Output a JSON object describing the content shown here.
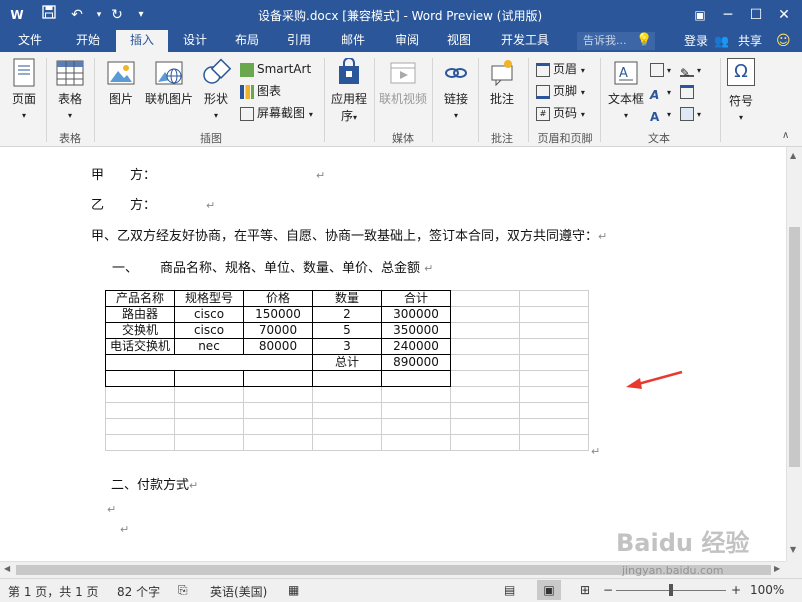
{
  "window": {
    "title": "设备采购.docx [兼容模式] - Word Preview (试用版)",
    "app_icon": "W",
    "qa_icons": [
      "save-icon",
      "undo-icon",
      "redo-icon",
      "customize-icon"
    ]
  },
  "tabs": [
    "文件",
    "开始",
    "插入",
    "设计",
    "布局",
    "引用",
    "邮件",
    "审阅",
    "视图",
    "开发工具"
  ],
  "active_tab": "插入",
  "tell_me": "告诉我...",
  "account": {
    "login": "登录",
    "share": "共享"
  },
  "ribbon": {
    "page": {
      "label": "页面"
    },
    "table": {
      "label": "表格",
      "group": "表格"
    },
    "illustrations": {
      "picture": "图片",
      "online_picture": "联机图片",
      "shapes": "形状",
      "smartart": "SmartArt",
      "chart": "图表",
      "screenshot": "屏幕截图",
      "group": "插图"
    },
    "apps": {
      "label": "应用程",
      "label2": "序"
    },
    "media": {
      "video": "联机视频",
      "group": "媒体"
    },
    "links": {
      "label": "链接"
    },
    "comments": {
      "comment": "批注",
      "group": "批注"
    },
    "header_footer": {
      "header": "页眉",
      "footer": "页脚",
      "page_number": "页码",
      "group": "页眉和页脚"
    },
    "text": {
      "textbox": "文本框",
      "group": "文本"
    },
    "symbols": {
      "symbol": "符号"
    }
  },
  "document": {
    "party_a": "甲　　方：",
    "party_b": "乙　　方：",
    "intro": "甲、乙双方经友好协商，在平等、自愿、协商一致基础上，签订本合同，双方共同遵守：",
    "section1_num": "一、",
    "section1_title": "商品名称、规格、单位、数量、单价、总金额",
    "table": {
      "headers": [
        "产品名称",
        "规格型号",
        "价格",
        "数量",
        "合计"
      ],
      "rows": [
        [
          "路由器",
          "cisco",
          "150000",
          "2",
          "300000"
        ],
        [
          "交换机",
          "cisco",
          "70000",
          "5",
          "350000"
        ],
        [
          "电话交换机",
          "nec",
          "80000",
          "3",
          "240000"
        ]
      ],
      "total_label": "总计",
      "total_value": "890000"
    },
    "section2": "二、付款方式",
    "paragraph_mark": "↵"
  },
  "status": {
    "page": "第 1 页，共 1 页",
    "words": "82 个字",
    "language": "英语(美国)",
    "zoom": "100%",
    "zoom_level": 1.0
  },
  "watermark": {
    "logo": "Baidu 经验",
    "url": "jingyan.baidu.com"
  },
  "colors": {
    "accent": "#2b579a",
    "arrow": "#e8392f"
  }
}
